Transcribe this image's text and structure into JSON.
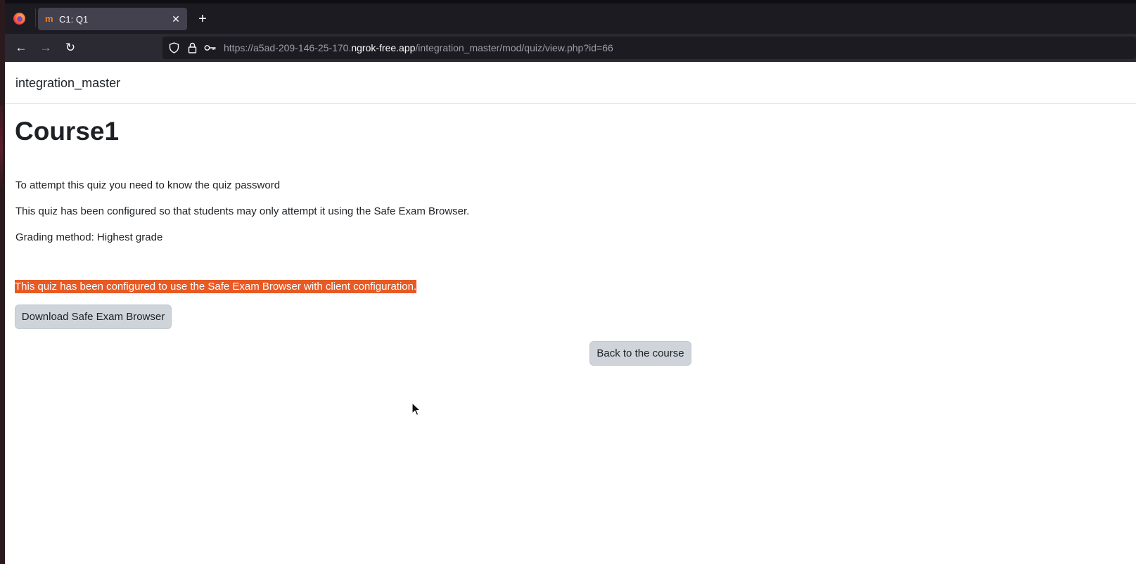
{
  "browser": {
    "tab": {
      "favicon": "m",
      "title": "C1: Q1",
      "close_glyph": "✕"
    },
    "new_tab_glyph": "+",
    "nav": {
      "back_glyph": "←",
      "forward_glyph": "→",
      "reload_glyph": "↻"
    },
    "url": {
      "prefix": "https://a5ad-209-146-25-170.",
      "host": "ngrok-free.app",
      "path": "/integration_master/mod/quiz/view.php?id=66"
    }
  },
  "page": {
    "site_name": "integration_master",
    "course_title": "Course1",
    "info": [
      "To attempt this quiz you need to know the quiz password",
      "This quiz has been configured so that students may only attempt it using the Safe Exam Browser.",
      "Grading method: Highest grade"
    ],
    "alert": "This quiz has been configured to use the Safe Exam Browser with client configuration.",
    "download_button": "Download Safe Exam Browser",
    "back_button": "Back to the course"
  },
  "colors": {
    "alert_bg": "#e85a24",
    "button_bg": "#ced4da",
    "moodle_orange": "#f98012"
  }
}
